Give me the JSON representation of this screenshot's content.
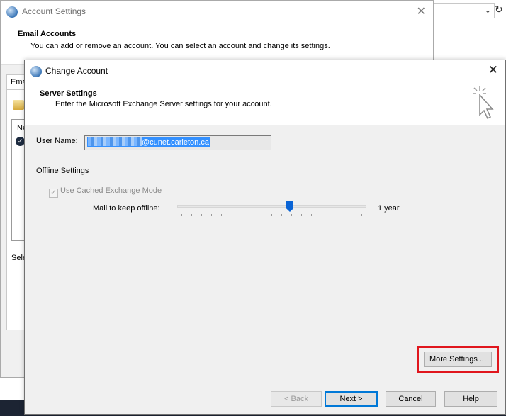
{
  "account_settings": {
    "title": "Account Settings",
    "header_title": "Email Accounts",
    "header_desc": "You can add or remove an account. You can select an account and change its settings.",
    "tab_label": "Ema",
    "list_column": "Na",
    "select_label": "Sele"
  },
  "change_account": {
    "title": "Change Account",
    "header_title": "Server Settings",
    "header_desc": "Enter the Microsoft Exchange Server settings for your account.",
    "user_name_label": "User Name:",
    "user_name_value_domain": "@cunet.carleton.ca",
    "offline_settings_label": "Offline Settings",
    "use_cached_label": "Use Cached Exchange Mode",
    "use_cached_checked": true,
    "mail_to_keep_label": "Mail to keep offline:",
    "mail_to_keep_value": "1 year",
    "more_settings_label": "More Settings ...",
    "back_label": "< Back",
    "next_label": "Next >",
    "cancel_label": "Cancel",
    "help_label": "Help"
  },
  "colors": {
    "highlight": "#e0161d",
    "selection": "#3390ff",
    "accent": "#0078d7"
  }
}
